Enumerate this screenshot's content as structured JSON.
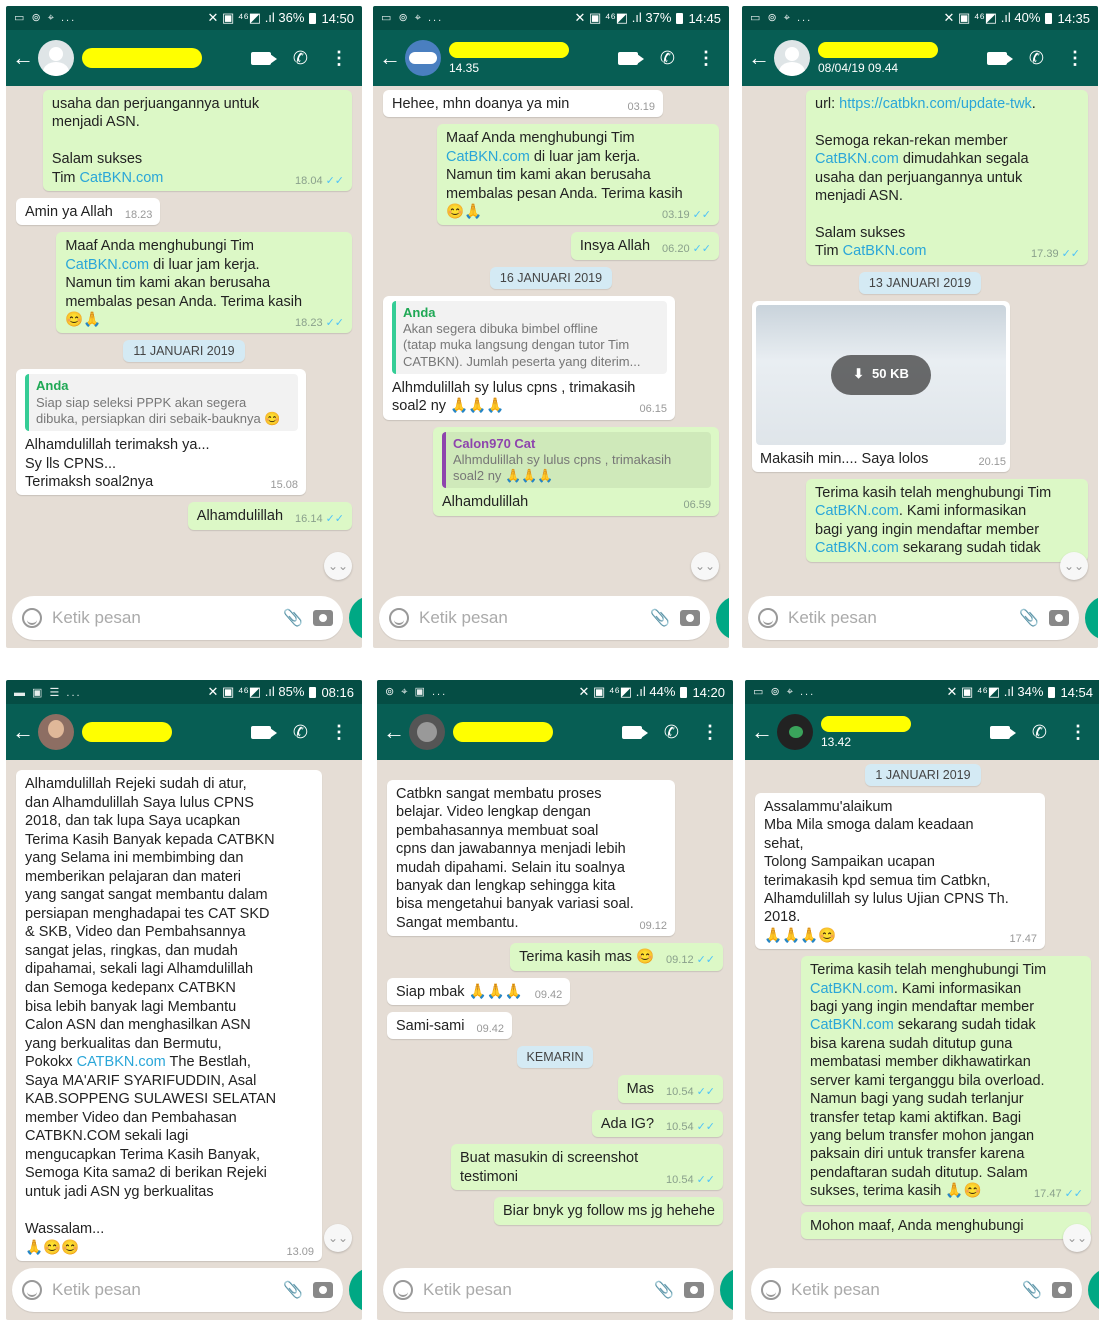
{
  "common": {
    "input_placeholder": "Ketik pesan",
    "tick": "✓✓"
  },
  "screens": [
    {
      "status": {
        "left": "▭ ⊚ ⌖ ...",
        "right": "✕ ▣ ⁴⁶◩ .ıl 36%",
        "time": "14:50"
      },
      "last_seen": "",
      "messages": [
        {
          "kind": "out",
          "text": "usaha dan perjuangannya untuk\nmenjadi ASN.\n\nSalam sukses\nTim ",
          "link": "CatBKN.com",
          "time": "18.04"
        },
        {
          "kind": "in",
          "text": "Amin ya Allah",
          "time": "18.23"
        },
        {
          "kind": "out",
          "text": "Maaf Anda menghubungi Tim\n",
          "link": "CatBKN.com",
          "text2": " di luar jam kerja.\nNamun tim kami akan berusaha\nmembalas pesan Anda. Terima kasih",
          "emoji": "😊🙏",
          "time": "18.23"
        },
        {
          "kind": "sys",
          "text": "11 JANUARI 2019"
        },
        {
          "kind": "in",
          "quote_name": "Anda",
          "quote": "Siap siap seleksi PPPK akan segera\ndibuka, persiapkan diri sebaik-bauknya 😊",
          "text": "Alhamdulillah terimaksh ya...\nSy lls CPNS...\nTerimaksh soal2nya",
          "time": "15.08"
        },
        {
          "kind": "out",
          "text": "Alhamdulillah",
          "time": "16.14"
        }
      ]
    },
    {
      "status": {
        "left": "▭ ⊚ ⌖ ...",
        "right": "✕ ▣ ⁴⁶◩ .ıl 37%",
        "time": "14:45"
      },
      "last_seen": "14.35",
      "messages": [
        {
          "kind": "in",
          "text": "Hehee, mhn doanya ya min",
          "time": "03.19"
        },
        {
          "kind": "out",
          "text": "Maaf Anda menghubungi Tim\n",
          "link": "CatBKN.com",
          "text2": " di luar jam kerja.\nNamun tim kami akan berusaha\nmembalas pesan Anda. Terima kasih",
          "emoji": "😊🙏",
          "time": "03.19"
        },
        {
          "kind": "out",
          "text": "Insya Allah",
          "time": "06.20"
        },
        {
          "kind": "sys",
          "text": "16 JANUARI 2019"
        },
        {
          "kind": "in",
          "quote_name": "Anda",
          "quote": "Akan segera dibuka bimbel offline\n(tatap muka langsung dengan tutor Tim\nCATBKN). Jumlah peserta yang diterim...",
          "text": "Alhmdulillah sy lulus cpns , trimakasih\nsoal2 ny 🙏🙏🙏",
          "time": "06.15"
        },
        {
          "kind": "out",
          "quote_name": "Calon970 Cat",
          "quote": "Alhmdulillah sy lulus cpns , trimakasih\nsoal2 ny 🙏🙏🙏",
          "text": "Alhamdulillah",
          "time": "06.59"
        }
      ]
    },
    {
      "status": {
        "left": "▭ ⊚ ⌖ ...",
        "right": "✕ ▣ ⁴⁶◩ .ıl 40%",
        "time": "14:35"
      },
      "last_seen": "08/04/19 09.44",
      "messages": [
        {
          "kind": "out",
          "text": "url: ",
          "link": "https://catbkn.com/update-twk",
          "text2": ".\n\nSemoga rekan-rekan member\n",
          "link2": "CatBKN.com",
          "text3": " dimudahkan segala\nusaha dan perjuangannya untuk\nmenjadi ASN.\n\nSalam sukses\nTim ",
          "link3": "CatBKN.com",
          "time": "17.39"
        },
        {
          "kind": "sys",
          "text": "13 JANUARI 2019"
        },
        {
          "kind": "img",
          "size": "50 KB",
          "text": "Makasih min.... Saya lolos",
          "time": "20.15"
        },
        {
          "kind": "out",
          "text": "Terima kasih telah menghubungi Tim\n",
          "link": "CatBKN.com",
          "text2": ". Kami informasikan\nbagi yang ingin mendaftar member\n",
          "link2": "CatBKN.com",
          "text3": " sekarang sudah tidak",
          "time": ""
        }
      ]
    },
    {
      "status": {
        "left": "▬ ▣ ☰ ...",
        "right": "✕ ▣ ⁴⁶◩ .ıl 85%",
        "time": "08:16"
      },
      "last_seen": "",
      "messages": [
        {
          "kind": "in",
          "text": "Alhamdulillah Rejeki sudah di atur,\ndan Alhamdulillah Saya lulus CPNS\n2018, dan tak lupa Saya ucapkan\nTerima Kasih Banyak kepada CATBKN\nyang Selama ini membimbing dan\nmemberikan pelajaran dan materi\nyang sangat sangat membantu dalam\npersiapan menghadapai tes CAT SKD\n& SKB, Video dan Pembahsannya\nsangat jelas, ringkas, dan mudah\ndipahamai, sekali lagi Alhamdulillah\ndan Semoga kedepanx CATBKN\nbisa lebih banyak lagi Membantu\nCalon ASN dan menghasilkan ASN\nyang berkualitas dan Bermutu,\nPokokx ",
          "link": "CATBKN.com",
          "text2": " The Bestlah,\nSaya MA'ARIF SYARIFUDDIN, Asal\nKAB.SOPPENG SULAWESI SELATAN\nmember Video dan Pembahasan\nCATBKN.COM  sekali lagi\nmengucapkan Terima Kasih Banyak,\nSemoga Kita sama2 di berikan Rejeki\nuntuk jadi ASN yg berkualitas\n\nWassalam...",
          "emoji": "🙏😊😊",
          "time": "13.09"
        }
      ]
    },
    {
      "status": {
        "left": "⊚ ⌖ ▣ ...",
        "right": "✕ ▣ ⁴⁶◩ .ıl 44%",
        "time": "14:20"
      },
      "last_seen": "",
      "messages": [
        {
          "kind": "in",
          "text": "Catbkn sangat membatu proses\nbelajar.  Video lengkap dengan\npembahasannya membuat soal\ncpns dan jawabannya menjadi lebih\nmudah dipahami.  Selain itu soalnya\nbanyak dan lengkap sehingga kita\nbisa mengetahui banyak variasi soal.\nSangat membantu.",
          "time": "09.12"
        },
        {
          "kind": "out",
          "text": "Terima kasih mas",
          "emoji": "😊",
          "time": "09.12"
        },
        {
          "kind": "in",
          "text": "Siap mbak 🙏🙏🙏",
          "time": "09.42"
        },
        {
          "kind": "in",
          "text": "Sami-sami",
          "time": "09.42"
        },
        {
          "kind": "sys",
          "text": "KEMARIN"
        },
        {
          "kind": "out",
          "text": "Mas",
          "time": "10.54"
        },
        {
          "kind": "out",
          "text": "Ada IG?",
          "time": "10.54"
        },
        {
          "kind": "out",
          "text": "Buat masukin di screenshot\ntestimoni",
          "time": "10.54"
        },
        {
          "kind": "out",
          "text": "Biar bnyk yg follow ms jg hehehe",
          "time": ""
        }
      ]
    },
    {
      "status": {
        "left": "▭ ⊚ ⌖ ...",
        "right": "✕ ▣ ⁴⁶◩ .ıl 34%",
        "time": "14:54"
      },
      "last_seen": "13.42",
      "messages": [
        {
          "kind": "sys",
          "text": "1 JANUARI 2019"
        },
        {
          "kind": "in",
          "text": "Assalammu'alaikum\nMba Mila smoga dalam keadaan\nsehat,\nTolong Sampaikan ucapan\nterimakasih kpd semua tim Catbkn,\nAlhamdulillah sy lulus Ujian CPNS Th.\n2018.",
          "emoji": "🙏🙏🙏😊",
          "time": "17.47"
        },
        {
          "kind": "out",
          "text": "Terima kasih telah menghubungi Tim\n",
          "link": "CatBKN.com",
          "text2": ". Kami informasikan\nbagi yang ingin mendaftar member\n",
          "link2": "CatBKN.com",
          "text3": " sekarang sudah tidak\nbisa karena sudah ditutup guna\nmembatasi member dikhawatirkan\nserver kami terganggu bila overload.\nNamun bagi yang sudah terlanjur\ntransfer tetap kami aktifkan. Bagi\nyang belum transfer mohon jangan\npaksain diri untuk transfer karena\npendaftaran sudah ditutup. Salam\nsukses, terima kasih",
          "emoji": "🙏😊",
          "time": "17.47"
        },
        {
          "kind": "out",
          "text": "Mohon maaf, Anda menghubungi",
          "time": ""
        }
      ]
    }
  ]
}
